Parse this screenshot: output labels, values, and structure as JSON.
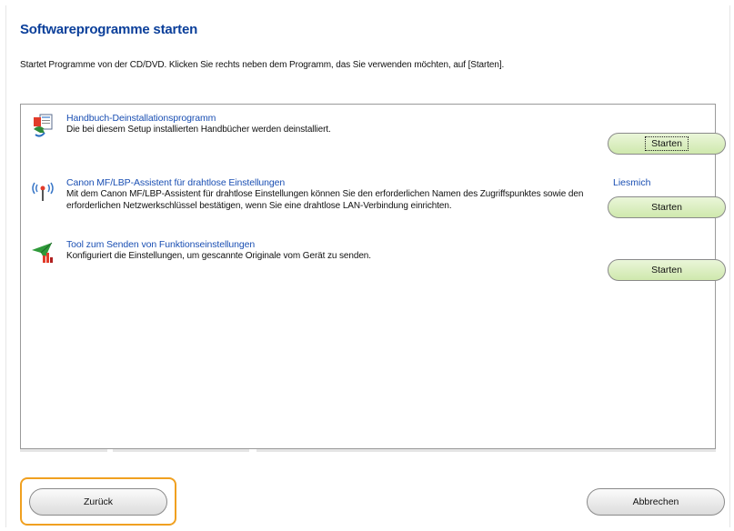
{
  "header": {
    "title": "Softwareprogramme starten",
    "instruction": "Startet Programme von der CD/DVD. Klicken Sie rechts neben dem Programm, das Sie verwenden möchten, auf [Starten]."
  },
  "programs": [
    {
      "icon": "manual-uninstall-icon",
      "title": "Handbuch-Deinstallationsprogramm",
      "description": "Die bei diesem Setup installierten Handbücher werden deinstalliert.",
      "start_label": "Starten"
    },
    {
      "icon": "wireless-antenna-icon",
      "title": "Canon MF/LBP-Assistent für drahtlose Einstellungen",
      "description": "Mit dem Canon MF/LBP-Assistent für drahtlose Einstellungen können Sie den erforderlichen Namen des Zugriffspunktes sowie den erforderlichen Netzwerkschlüssel bestätigen, wenn Sie eine drahtlose LAN-Verbindung einrichten.",
      "readme_label": "Liesmich",
      "start_label": "Starten"
    },
    {
      "icon": "send-function-settings-icon",
      "title": "Tool zum Senden von Funktionseinstellungen",
      "description": "Konfiguriert die Einstellungen, um gescannte Originale vom Gerät zu senden.",
      "start_label": "Starten"
    }
  ],
  "footer": {
    "back_label": "Zurück",
    "cancel_label": "Abbrechen"
  },
  "colors": {
    "title": "#0b3f9a",
    "link": "#1a4fb3",
    "start_button": "#d8edbd",
    "highlight": "#f0a020"
  }
}
